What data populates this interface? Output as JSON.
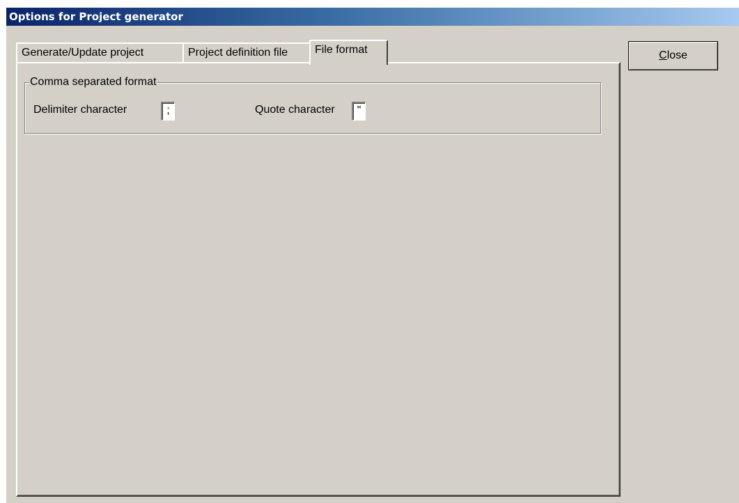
{
  "window": {
    "title": "Options for Project generator"
  },
  "tabs": [
    {
      "label": "Generate/Update project",
      "selected": false
    },
    {
      "label": "Project definition file",
      "selected": false
    },
    {
      "label": "File format",
      "selected": true
    }
  ],
  "csv_group": {
    "title": "Comma separated format",
    "delimiter_label": "Delimiter character",
    "delimiter_value": ";",
    "quote_label": "Quote character",
    "quote_value": "\""
  },
  "close_button": {
    "mnemonic": "C",
    "rest": "lose"
  },
  "colors": {
    "face": "#d4d0c8",
    "title_start": "#0a246a",
    "title_end": "#a6caf0"
  }
}
